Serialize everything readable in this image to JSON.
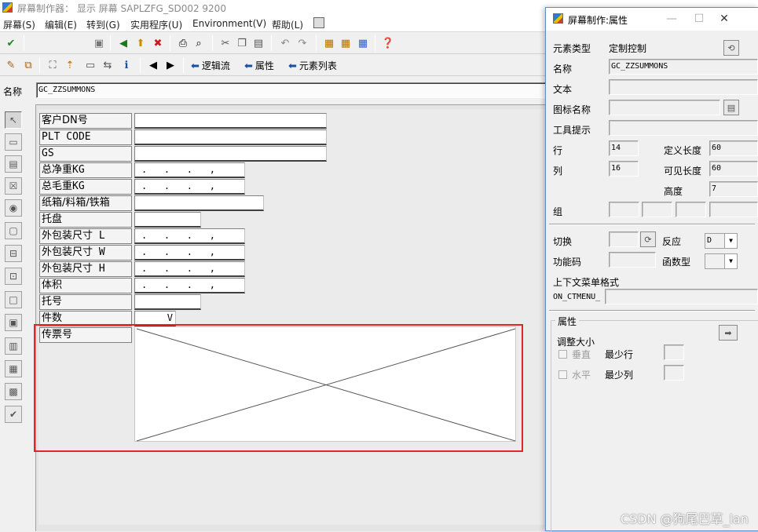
{
  "window": {
    "title": "屏幕制作器：  显示 屏幕 SAPLZFG_SD002 9200"
  },
  "menu": [
    "屏幕(S)",
    "编辑(E)",
    "转到(G)",
    "实用程序(U)",
    "Environment(V)",
    "帮助(L)"
  ],
  "toolbar2": {
    "logic_flow": "逻辑流",
    "attributes": "属性",
    "element_list": "元素列表"
  },
  "name_bar": {
    "label": "名称",
    "value": "GC_ZZSUMMONS"
  },
  "screen_fields": [
    {
      "label": "客户DN号",
      "value": ""
    },
    {
      "label": "PLT CODE",
      "value": ""
    },
    {
      "label": "GS",
      "value": ""
    },
    {
      "label": "总净重KG",
      "value": ".   .   .   ,"
    },
    {
      "label": "总毛重KG",
      "value": ".   .   .   ,"
    },
    {
      "label": "纸箱/料箱/铁箱",
      "value": ""
    },
    {
      "label": "托盘",
      "value": ""
    },
    {
      "label": "外包装尺寸 L",
      "value": ".   .   .   ,"
    },
    {
      "label": "外包装尺寸 W",
      "value": ".   .   .   ,"
    },
    {
      "label": "外包装尺寸 H",
      "value": ".   .   .   ,"
    },
    {
      "label": "体积",
      "value": ".   .   .   ,"
    },
    {
      "label": "托号",
      "value": ""
    },
    {
      "label": "件数",
      "value": "V"
    },
    {
      "label": "传票号",
      "value": ""
    }
  ],
  "dialog": {
    "title": "屏幕制作:属性",
    "element_type_label": "元素类型",
    "element_type_value": "定制控制",
    "name_label": "名称",
    "name_value": "GC_ZZSUMMONS",
    "text_label": "文本",
    "text_value": "",
    "icon_name_label": "图标名称",
    "tooltip_label": "工具提示",
    "row_label": "行",
    "row_value": "14",
    "col_label": "列",
    "col_value": "16",
    "def_length_label": "定义长度",
    "def_length_value": "60",
    "vis_length_label": "可见长度",
    "vis_length_value": "60",
    "height_label": "高度",
    "height_value": "7",
    "group_label": "组",
    "switch_label": "切换",
    "reaction_label": "反应",
    "reaction_value": "D",
    "fcode_label": "功能码",
    "ftype_label": "函数型",
    "context_menu_label": "上下文菜单格式",
    "context_menu_prefix": "ON_CTMENU_",
    "attributes_group": "属性",
    "resize_label": "调整大小",
    "vertical_label": "垂直",
    "min_rows_label": "最少行",
    "horizontal_label": "水平",
    "min_cols_label": "最少列"
  },
  "watermark": "CSDN @狗尾巴草_lan",
  "colors": {
    "highlight": "#e0262a",
    "dialog_border": "#5a8fcf"
  }
}
